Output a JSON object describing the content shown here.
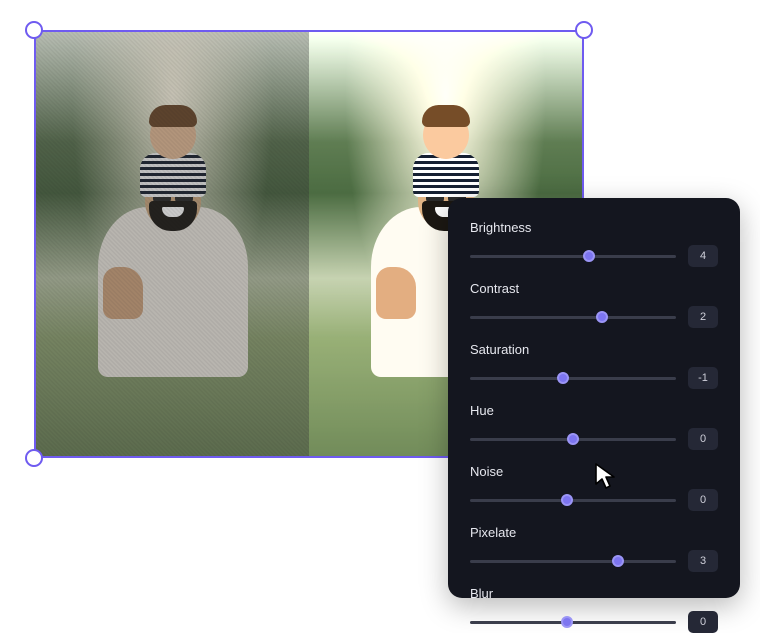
{
  "canvas": {
    "border_color": "#6f5bf0",
    "handle_fill": "#ffffff"
  },
  "panel": {
    "bg": "#14161f",
    "accent": "#7d75f0",
    "sliders": [
      {
        "label": "Brightness",
        "value": 4,
        "percent": 58
      },
      {
        "label": "Contrast",
        "value": 2,
        "percent": 64
      },
      {
        "label": "Saturation",
        "value": -1,
        "percent": 45
      },
      {
        "label": "Hue",
        "value": 0,
        "percent": 50
      },
      {
        "label": "Noise",
        "value": 0,
        "percent": 47
      },
      {
        "label": "Pixelate",
        "value": 3,
        "percent": 72
      },
      {
        "label": "Blur",
        "value": 0,
        "percent": 47
      }
    ]
  }
}
